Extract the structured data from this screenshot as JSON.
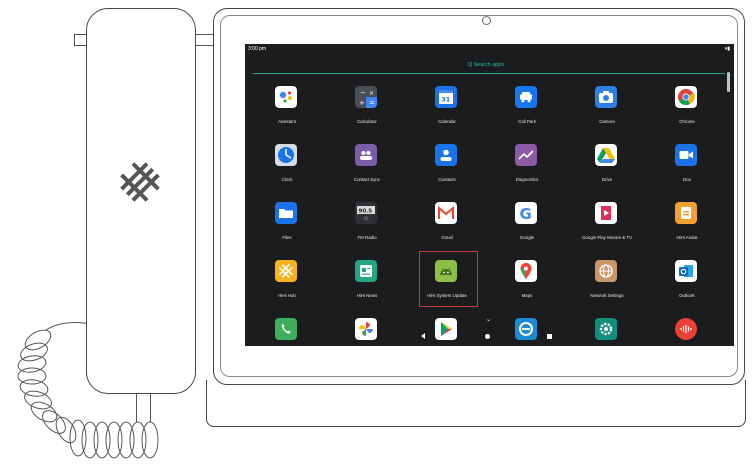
{
  "status_bar": {
    "time": "3:00 pm",
    "icons": "▾▮"
  },
  "search": {
    "placeholder": "Q  Search apps"
  },
  "apps": [
    {
      "label": "Assistant",
      "icon": "assistant-icon"
    },
    {
      "label": "Calculator",
      "icon": "calculator-icon"
    },
    {
      "label": "Calendar",
      "icon": "calendar-icon",
      "badge": "31"
    },
    {
      "label": "Call Park",
      "icon": "call-park-icon"
    },
    {
      "label": "Camera",
      "icon": "camera-icon"
    },
    {
      "label": "Chrome",
      "icon": "chrome-icon"
    },
    {
      "label": "Clock",
      "icon": "clock-icon"
    },
    {
      "label": "Contact Sync",
      "icon": "contact-sync-icon"
    },
    {
      "label": "Contacts",
      "icon": "contacts-icon"
    },
    {
      "label": "Diagnostics",
      "icon": "diagnostics-icon"
    },
    {
      "label": "Drive",
      "icon": "drive-icon"
    },
    {
      "label": "Duo",
      "icon": "duo-icon"
    },
    {
      "label": "Files",
      "icon": "files-icon"
    },
    {
      "label": "FM Radio",
      "icon": "fm-radio-icon",
      "badge": "90.5"
    },
    {
      "label": "Gmail",
      "icon": "gmail-icon"
    },
    {
      "label": "Google",
      "icon": "google-icon"
    },
    {
      "label": "Google Play Movies & TV",
      "icon": "play-movies-icon"
    },
    {
      "label": "HiHi Assist",
      "icon": "hihi-assist-icon"
    },
    {
      "label": "HiHi Hub",
      "icon": "hihi-hub-icon"
    },
    {
      "label": "HiHi News",
      "icon": "hihi-news-icon"
    },
    {
      "label": "HiHi System Update",
      "icon": "android-update-icon"
    },
    {
      "label": "Maps",
      "icon": "maps-icon"
    },
    {
      "label": "Network Settings",
      "icon": "network-settings-icon"
    },
    {
      "label": "OutlooK",
      "icon": "outlook-icon"
    },
    {
      "label": "",
      "icon": "phone-icon"
    },
    {
      "label": "",
      "icon": "photos-icon"
    },
    {
      "label": "",
      "icon": "play-store-icon"
    },
    {
      "label": "",
      "icon": "remote-icon"
    },
    {
      "label": "",
      "icon": "settings-icon"
    },
    {
      "label": "",
      "icon": "recorder-icon"
    }
  ],
  "colors": {
    "screen_bg": "#1b1c1e",
    "accent": "#2bbf9e",
    "highlight": "#c8383c"
  }
}
